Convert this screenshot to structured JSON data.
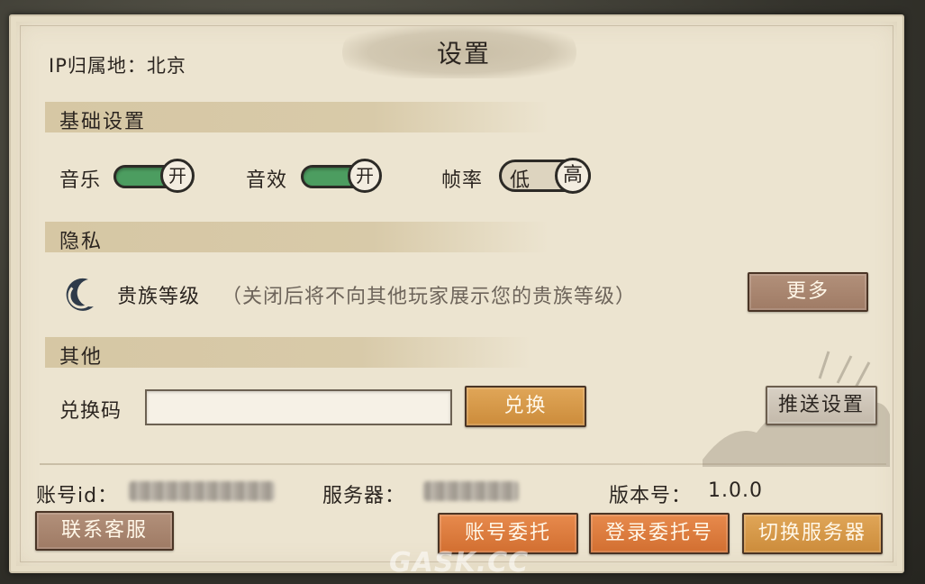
{
  "ip_location": "IP归属地：北京",
  "title": "设置",
  "basic": {
    "heading": "基础设置",
    "music_label": "音乐",
    "music_state": "开",
    "sfx_label": "音效",
    "sfx_state": "开",
    "framerate_label": "帧率",
    "framerate_low": "低",
    "framerate_high": "高"
  },
  "privacy": {
    "heading": "隐私",
    "noble_label": "贵族等级",
    "noble_desc": "（关闭后将不向其他玩家展示您的贵族等级）",
    "more_button": "更多"
  },
  "other": {
    "heading": "其他",
    "redeem_label": "兑换码",
    "redeem_value": "",
    "redeem_button": "兑换",
    "push_button": "推送设置"
  },
  "footer": {
    "account_label": "账号id：",
    "server_label": "服务器：",
    "version_label": "版本号：",
    "version_value": "1.0.0",
    "contact_button": "联系客服",
    "delegate_button": "账号委托",
    "login_delegate_button": "登录委托号",
    "switch_server_button": "切换服务器"
  },
  "watermark": "GASK.CC",
  "colors": {
    "toggle_on": "#4c9d60",
    "button_orange": "#d26f31",
    "button_gold": "#cc8c3b",
    "button_brown": "#9f7b65"
  }
}
